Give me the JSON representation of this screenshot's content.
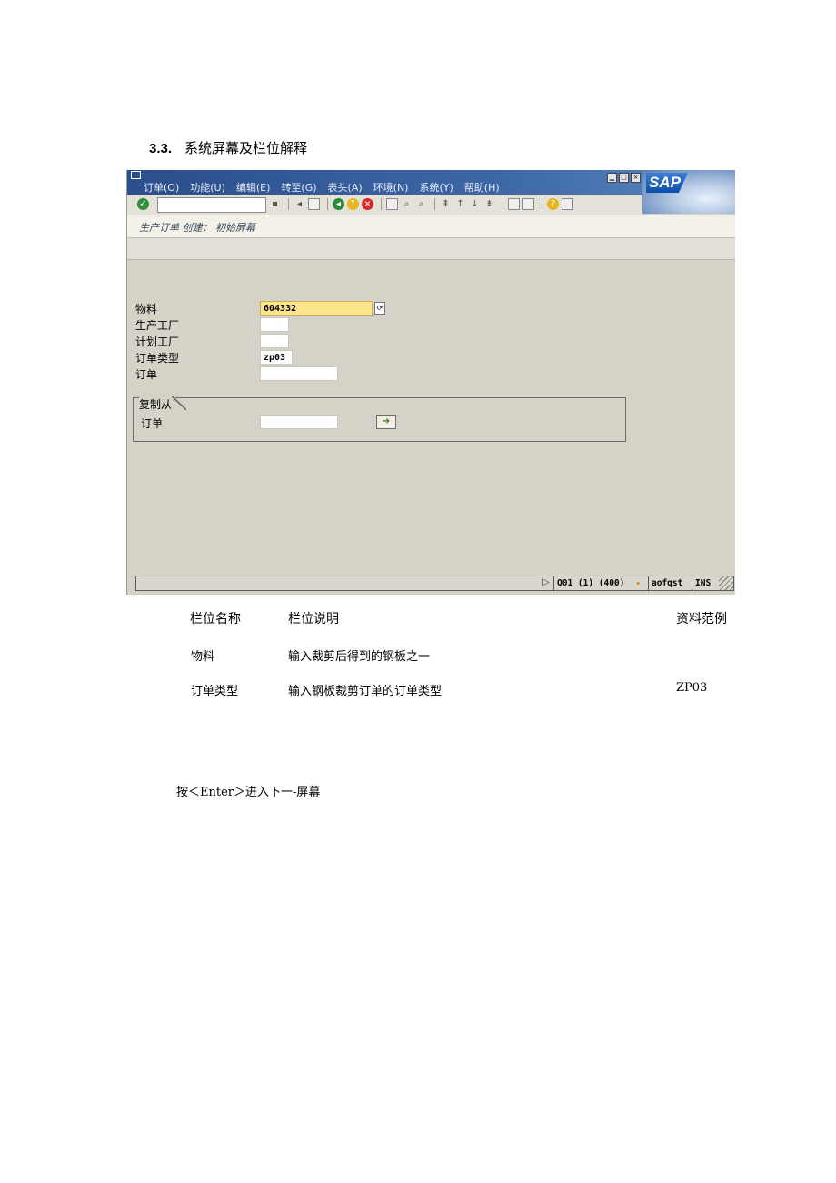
{
  "heading": {
    "number": "3.3.",
    "title": "系统屏幕及栏位解释"
  },
  "sap": {
    "menu": [
      "订单(O)",
      "功能(U)",
      "编辑(E)",
      "转至(G)",
      "表头(A)",
      "环境(N)",
      "系统(Y)",
      "帮助(H)"
    ],
    "logo": "SAP",
    "screen_title": "生产订单 创建： 初始屏幕",
    "fields": [
      {
        "label": "物料",
        "value": "604332"
      },
      {
        "label": "生产工厂",
        "value": ""
      },
      {
        "label": "计划工厂",
        "value": ""
      },
      {
        "label": "订单类型",
        "value": "zp03"
      },
      {
        "label": "订单",
        "value": ""
      }
    ],
    "copy_group": {
      "title": "复制从",
      "label": "订单",
      "value": ""
    },
    "status": {
      "system": "Q01 (1) (400)",
      "server": "aofqst",
      "mode": "INS"
    },
    "colors": {
      "title_bar": "#2b4e8c",
      "background": "#d5d3c8",
      "focus_field": "#fde58c"
    }
  },
  "table": {
    "headers": [
      "栏位名称",
      "栏位说明",
      "资料范例"
    ],
    "rows": [
      {
        "name": "物料",
        "desc": "输入裁剪后得到的钢板之一",
        "example": ""
      },
      {
        "name": "订单类型",
        "desc": "输入钢板裁剪订单的订单类型",
        "example": "ZP03"
      }
    ]
  },
  "note": "按＜Enter＞进入下一-屏幕"
}
